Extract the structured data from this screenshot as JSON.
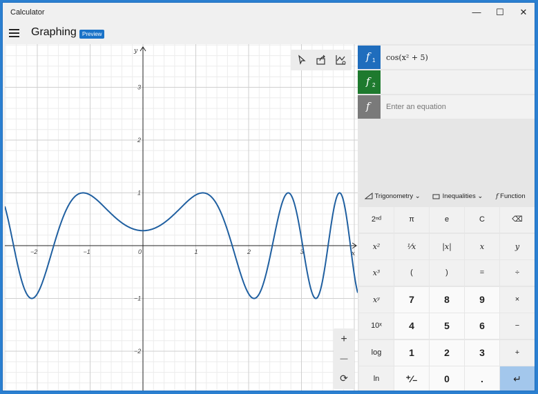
{
  "window": {
    "title": "Calculator",
    "minimize": "—",
    "maximize": "☐",
    "close": "✕"
  },
  "header": {
    "title": "Graphing",
    "badge": "Preview"
  },
  "graph": {
    "axis_x_label": "x",
    "axis_y_label": "y",
    "x_ticks": [
      "−2",
      "−1",
      "0",
      "1",
      "2",
      "3"
    ],
    "y_ticks": [
      "3",
      "2",
      "1",
      "−1",
      "−2"
    ],
    "toolbar": [
      "select-pointer-icon",
      "share-icon",
      "graph-options-icon"
    ],
    "zoom": {
      "in": "+",
      "out": "—",
      "reset": "⟳"
    },
    "line_color": "#1f5fa0"
  },
  "chart_data": {
    "type": "line",
    "function": "cos(x^2 + 5)",
    "xlim": [
      -2.5,
      4.1
    ],
    "ylim": [
      -2.8,
      3.8
    ],
    "grid": true
  },
  "equations": [
    {
      "symbol": "f",
      "index": "1",
      "text": "cos(x² + 5)",
      "color": "#1f6dbd"
    },
    {
      "symbol": "f",
      "index": "2",
      "text": "",
      "color": "#1e7a2e"
    },
    {
      "symbol": "f",
      "index": "",
      "placeholder": "Enter an equation",
      "color": "#7a7a7a"
    }
  ],
  "dropdowns": {
    "trig": "Trigonometry",
    "ineq": "Inequalities",
    "func": "Function"
  },
  "keys": [
    [
      "2ⁿᵈ",
      "π",
      "e",
      "C",
      "⌫"
    ],
    [
      "x²",
      "¹⁄x",
      "|x|",
      "x",
      "y"
    ],
    [
      "x³",
      "(",
      ")",
      "=",
      "÷"
    ],
    [
      "xʸ",
      "7",
      "8",
      "9",
      "×"
    ],
    [
      "10ˣ",
      "4",
      "5",
      "6",
      "−"
    ],
    [
      "log",
      "1",
      "2",
      "3",
      "+"
    ],
    [
      "ln",
      "⁺⁄₋",
      "0",
      ".",
      "↵"
    ]
  ]
}
